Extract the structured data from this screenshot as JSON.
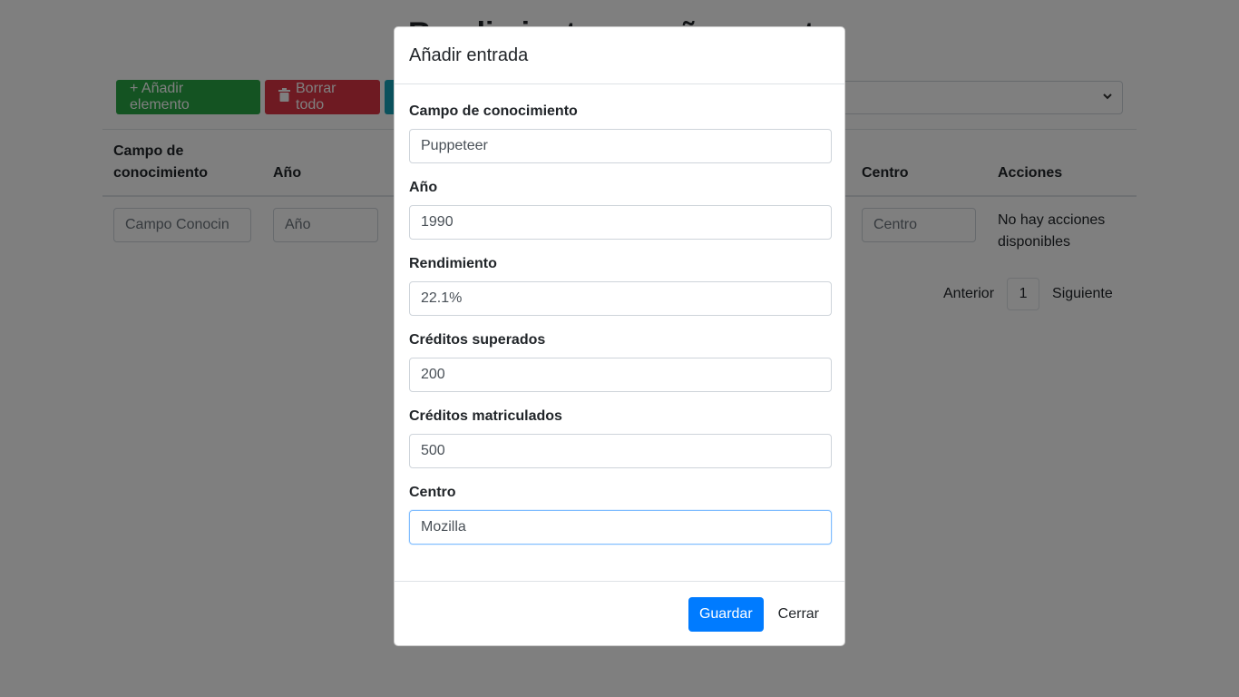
{
  "page": {
    "title": "Rendimiento por año y centro"
  },
  "toolbar": {
    "add_label": "+ Añadir elemento",
    "delete_label": "Borrar todo",
    "delete_icon": "trash-icon",
    "select_chevron": "chevron-down-icon"
  },
  "table": {
    "headers": {
      "campo": "Campo de conocimiento",
      "anio": "Año",
      "centro": "Centro",
      "acciones": "Acciones"
    },
    "filters": {
      "campo_placeholder": "Campo Conocin",
      "anio_placeholder": "Año",
      "centro_placeholder": "Centro"
    },
    "no_actions": "No hay acciones disponibles"
  },
  "pagination": {
    "prev": "Anterior",
    "current": "1",
    "next": "Siguiente"
  },
  "modal": {
    "title": "Añadir entrada",
    "fields": [
      {
        "label": "Campo de conocimiento",
        "value": "Puppeteer"
      },
      {
        "label": "Año",
        "value": "1990"
      },
      {
        "label": "Rendimiento",
        "value": "22.1%"
      },
      {
        "label": "Créditos superados",
        "value": "200"
      },
      {
        "label": "Créditos matriculados",
        "value": "500"
      },
      {
        "label": "Centro",
        "value": "Mozilla"
      }
    ],
    "save_label": "Guardar",
    "close_label": "Cerrar"
  },
  "colors": {
    "primary": "#007bff",
    "success": "#28a745",
    "danger": "#dc3545",
    "info": "#17a2b8"
  }
}
